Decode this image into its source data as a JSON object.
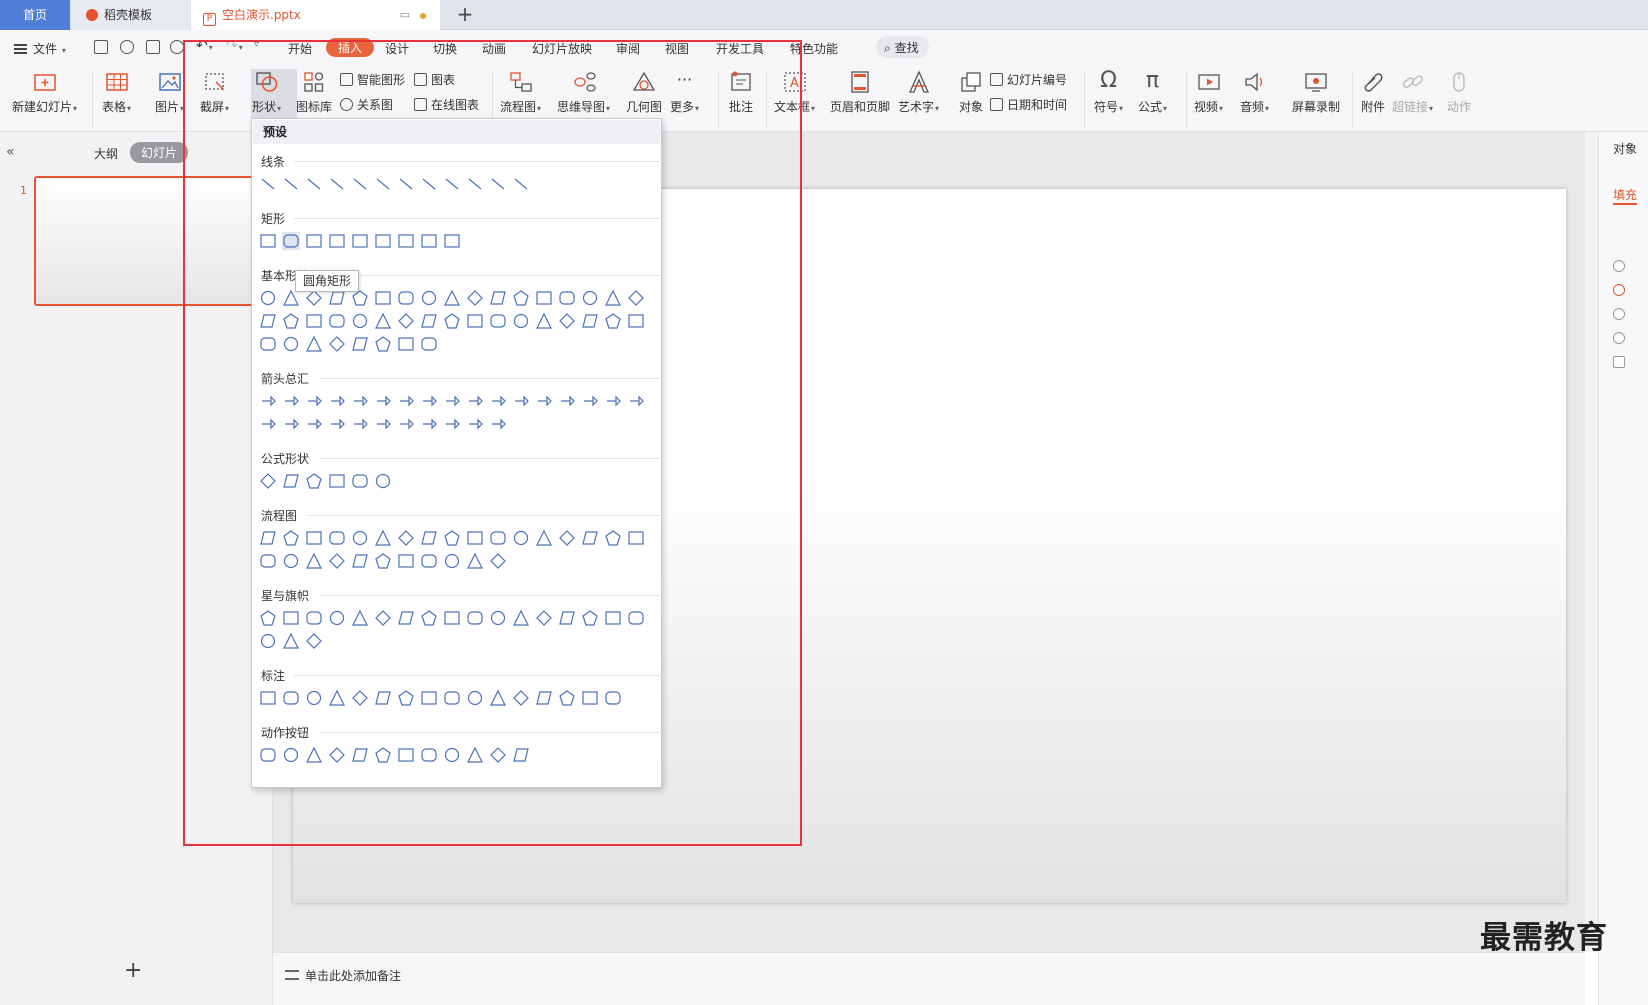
{
  "tabs": [
    {
      "label": "首页"
    },
    {
      "label": "稻壳模板"
    },
    {
      "label": "空白演示.pptx"
    }
  ],
  "menubar": {
    "file": "文件",
    "items": [
      "开始",
      "插入",
      "设计",
      "切换",
      "动画",
      "幻灯片放映",
      "审阅",
      "视图",
      "开发工具",
      "特色功能"
    ],
    "active": "插入",
    "search": "查找"
  },
  "ribbon": {
    "new_slide": "新建幻灯片",
    "table": "表格",
    "picture": "图片",
    "screenshot": "截屏",
    "shape": "形状",
    "icon_lib": "图标库",
    "smart_art": "智能图形",
    "chart": "图表",
    "relation": "关系图",
    "online_chart": "在线图表",
    "flowchart": "流程图",
    "mindmap": "思维导图",
    "geometry": "几何图",
    "more": "更多",
    "comment": "批注",
    "textbox": "文本框",
    "header_footer": "页眉和页脚",
    "wordart": "艺术字",
    "object": "对象",
    "slide_number": "幻灯片编号",
    "date_time": "日期和时间",
    "symbol": "符号",
    "formula": "公式",
    "video": "视频",
    "audio": "音频",
    "screen_record": "屏幕录制",
    "attachment": "附件",
    "hyperlink": "超链接",
    "action": "动作"
  },
  "left_panel": {
    "outline": "大纲",
    "slides": "幻灯片",
    "slide_number": "1",
    "add": "+"
  },
  "shapes_popup": {
    "header": "预设",
    "categories": [
      {
        "name": "线条",
        "count": 12
      },
      {
        "name": "矩形",
        "count": 9
      },
      {
        "name": "基本形状",
        "count": 42
      },
      {
        "name": "箭头总汇",
        "count": 28
      },
      {
        "name": "公式形状",
        "count": 6
      },
      {
        "name": "流程图",
        "count": 28
      },
      {
        "name": "星与旗帜",
        "count": 20
      },
      {
        "name": "标注",
        "count": 16
      },
      {
        "name": "动作按钮",
        "count": 12
      }
    ],
    "tooltip": "圆角矩形"
  },
  "notes": {
    "placeholder": "单击此处添加备注"
  },
  "right_panel": {
    "title": "对象",
    "fill": "填充"
  },
  "watermark": "最需教育",
  "colors": {
    "accent": "#e5552f",
    "home_tab": "#4f7dd8",
    "icon_blue": "#4a72b8",
    "highlight": "#e8333a"
  }
}
